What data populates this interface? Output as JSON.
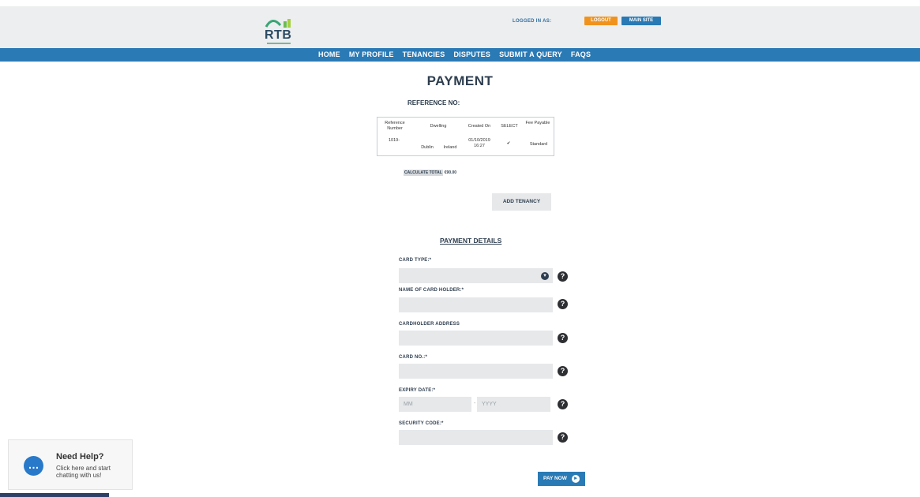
{
  "header": {
    "logo_text": "RTB",
    "logged_in_label": "LOGGED IN AS:",
    "logout_label": "LOGOUT",
    "main_site_label": "MAIN SITE"
  },
  "nav": {
    "items": [
      "HOME",
      "MY PROFILE",
      "TENANCIES",
      "DISPUTES",
      "SUBMIT A QUERY",
      "FAQS"
    ]
  },
  "page": {
    "title": "PAYMENT",
    "reference_label": "REFERENCE NO:"
  },
  "table": {
    "headers": [
      "Reference Number",
      "Dwelling",
      "Created On",
      "SELECT",
      "Fee Payable"
    ],
    "rows": [
      {
        "reference": "1019-",
        "dwelling_city": "Dublin",
        "dwelling_country": "Ireland",
        "created_on": "01/10/2019 16:27",
        "selected": "✔",
        "fee": "Standard"
      }
    ]
  },
  "total": {
    "button_label": "CALCULATE TOTAL",
    "value": "€90.00"
  },
  "add_tenancy_label": "ADD TENANCY",
  "payment": {
    "title": "PAYMENT DETAILS",
    "card_type_label": "CARD TYPE:*",
    "card_holder_label": "NAME OF CARD HOLDER:*",
    "address_label": "CARDHOLDER ADDRESS",
    "card_no_label": "CARD NO.:*",
    "expiry_label": "EXPIRY DATE:*",
    "expiry_month_placeholder": "MM",
    "expiry_separator": "-",
    "expiry_year_placeholder": "YYYY",
    "security_label": "SECURITY CODE:*",
    "help_glyph": "?",
    "pay_now_label": "PAY NOW"
  },
  "chat": {
    "title": "Need Help?",
    "subtitle": "Click here and start chatting with us!"
  },
  "colors": {
    "nav": "#2a7ab5",
    "logout": "#f0931e",
    "main_site": "#2879b4",
    "field": "#e6e8ea",
    "chat_icon": "#2879c9"
  }
}
